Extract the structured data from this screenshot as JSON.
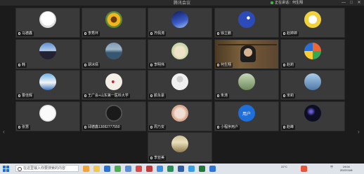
{
  "window": {
    "title": "腾讯会议",
    "speaking_label": "正在讲话：何生翔",
    "min": "—",
    "max": "□",
    "close": "✕"
  },
  "participants": [
    {
      "name": "马德鑫",
      "avatar": "cartoon"
    },
    {
      "name": "李秀环",
      "avatar": "sunflower"
    },
    {
      "name": "齐佩涛",
      "avatar": "nightsky"
    },
    {
      "name": "徐立鹏",
      "avatar": "blue-moon"
    },
    {
      "name": "赵婷婷",
      "avatar": "yellow-cartoon"
    },
    {
      "name": "韩",
      "avatar": "piano"
    },
    {
      "name": "胡冰倩",
      "avatar": "lake"
    },
    {
      "name": "李明伟",
      "avatar": "cat"
    },
    {
      "name": "何生翔",
      "avatar": "video"
    },
    {
      "name": "赵莉",
      "avatar": "rubik"
    },
    {
      "name": "曹佳辉",
      "avatar": "landscape"
    },
    {
      "name": "王广会+山东第一医科大学",
      "avatar": "ink-bird"
    },
    {
      "name": "颜永豪",
      "avatar": "default"
    },
    {
      "name": "朱涛",
      "avatar": "portrait"
    },
    {
      "name": "宋莉",
      "avatar": "tower"
    },
    {
      "name": "张慧",
      "avatar": "happy-text"
    },
    {
      "name": "邱德鑫13082777550",
      "avatar": "dark"
    },
    {
      "name": "周乃安",
      "avatar": "food"
    },
    {
      "name": "小程序用户",
      "avatar": "blue-user",
      "avatar_text": "用户"
    },
    {
      "name": "赵峰",
      "avatar": "galaxy"
    },
    {
      "name": "李亚美",
      "avatar": "road"
    }
  ],
  "taskbar": {
    "search_placeholder": "在这里输入你要搜索的内容",
    "weather": "22°C",
    "ime": "中",
    "time": "19:04",
    "date": "2022/11/8"
  },
  "colors": {
    "accent": "#1e6fd9",
    "tile": "#3a3a3a",
    "bg": "#1b1b1b"
  }
}
